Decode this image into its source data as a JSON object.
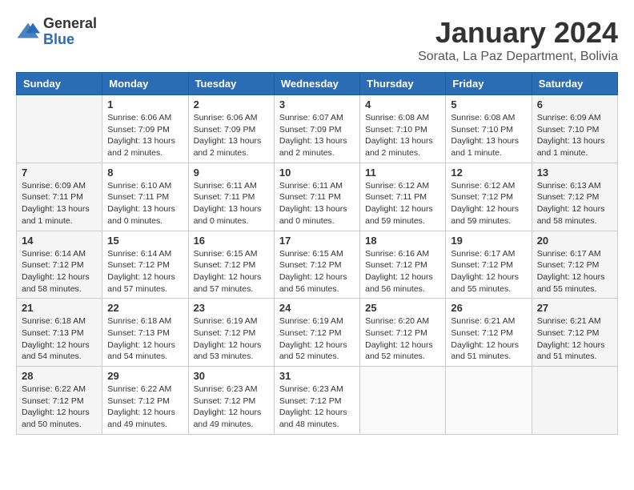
{
  "logo": {
    "general": "General",
    "blue": "Blue"
  },
  "title": "January 2024",
  "location": "Sorata, La Paz Department, Bolivia",
  "days_header": [
    "Sunday",
    "Monday",
    "Tuesday",
    "Wednesday",
    "Thursday",
    "Friday",
    "Saturday"
  ],
  "weeks": [
    [
      {
        "day": "",
        "info": ""
      },
      {
        "day": "1",
        "info": "Sunrise: 6:06 AM\nSunset: 7:09 PM\nDaylight: 13 hours and 2 minutes."
      },
      {
        "day": "2",
        "info": "Sunrise: 6:06 AM\nSunset: 7:09 PM\nDaylight: 13 hours and 2 minutes."
      },
      {
        "day": "3",
        "info": "Sunrise: 6:07 AM\nSunset: 7:09 PM\nDaylight: 13 hours and 2 minutes."
      },
      {
        "day": "4",
        "info": "Sunrise: 6:08 AM\nSunset: 7:10 PM\nDaylight: 13 hours and 2 minutes."
      },
      {
        "day": "5",
        "info": "Sunrise: 6:08 AM\nSunset: 7:10 PM\nDaylight: 13 hours and 1 minute."
      },
      {
        "day": "6",
        "info": "Sunrise: 6:09 AM\nSunset: 7:10 PM\nDaylight: 13 hours and 1 minute."
      }
    ],
    [
      {
        "day": "7",
        "info": "Sunrise: 6:09 AM\nSunset: 7:11 PM\nDaylight: 13 hours and 1 minute."
      },
      {
        "day": "8",
        "info": "Sunrise: 6:10 AM\nSunset: 7:11 PM\nDaylight: 13 hours and 0 minutes."
      },
      {
        "day": "9",
        "info": "Sunrise: 6:11 AM\nSunset: 7:11 PM\nDaylight: 13 hours and 0 minutes."
      },
      {
        "day": "10",
        "info": "Sunrise: 6:11 AM\nSunset: 7:11 PM\nDaylight: 13 hours and 0 minutes."
      },
      {
        "day": "11",
        "info": "Sunrise: 6:12 AM\nSunset: 7:11 PM\nDaylight: 12 hours and 59 minutes."
      },
      {
        "day": "12",
        "info": "Sunrise: 6:12 AM\nSunset: 7:12 PM\nDaylight: 12 hours and 59 minutes."
      },
      {
        "day": "13",
        "info": "Sunrise: 6:13 AM\nSunset: 7:12 PM\nDaylight: 12 hours and 58 minutes."
      }
    ],
    [
      {
        "day": "14",
        "info": "Sunrise: 6:14 AM\nSunset: 7:12 PM\nDaylight: 12 hours and 58 minutes."
      },
      {
        "day": "15",
        "info": "Sunrise: 6:14 AM\nSunset: 7:12 PM\nDaylight: 12 hours and 57 minutes."
      },
      {
        "day": "16",
        "info": "Sunrise: 6:15 AM\nSunset: 7:12 PM\nDaylight: 12 hours and 57 minutes."
      },
      {
        "day": "17",
        "info": "Sunrise: 6:15 AM\nSunset: 7:12 PM\nDaylight: 12 hours and 56 minutes."
      },
      {
        "day": "18",
        "info": "Sunrise: 6:16 AM\nSunset: 7:12 PM\nDaylight: 12 hours and 56 minutes."
      },
      {
        "day": "19",
        "info": "Sunrise: 6:17 AM\nSunset: 7:12 PM\nDaylight: 12 hours and 55 minutes."
      },
      {
        "day": "20",
        "info": "Sunrise: 6:17 AM\nSunset: 7:12 PM\nDaylight: 12 hours and 55 minutes."
      }
    ],
    [
      {
        "day": "21",
        "info": "Sunrise: 6:18 AM\nSunset: 7:13 PM\nDaylight: 12 hours and 54 minutes."
      },
      {
        "day": "22",
        "info": "Sunrise: 6:18 AM\nSunset: 7:13 PM\nDaylight: 12 hours and 54 minutes."
      },
      {
        "day": "23",
        "info": "Sunrise: 6:19 AM\nSunset: 7:12 PM\nDaylight: 12 hours and 53 minutes."
      },
      {
        "day": "24",
        "info": "Sunrise: 6:19 AM\nSunset: 7:12 PM\nDaylight: 12 hours and 52 minutes."
      },
      {
        "day": "25",
        "info": "Sunrise: 6:20 AM\nSunset: 7:12 PM\nDaylight: 12 hours and 52 minutes."
      },
      {
        "day": "26",
        "info": "Sunrise: 6:21 AM\nSunset: 7:12 PM\nDaylight: 12 hours and 51 minutes."
      },
      {
        "day": "27",
        "info": "Sunrise: 6:21 AM\nSunset: 7:12 PM\nDaylight: 12 hours and 51 minutes."
      }
    ],
    [
      {
        "day": "28",
        "info": "Sunrise: 6:22 AM\nSunset: 7:12 PM\nDaylight: 12 hours and 50 minutes."
      },
      {
        "day": "29",
        "info": "Sunrise: 6:22 AM\nSunset: 7:12 PM\nDaylight: 12 hours and 49 minutes."
      },
      {
        "day": "30",
        "info": "Sunrise: 6:23 AM\nSunset: 7:12 PM\nDaylight: 12 hours and 49 minutes."
      },
      {
        "day": "31",
        "info": "Sunrise: 6:23 AM\nSunset: 7:12 PM\nDaylight: 12 hours and 48 minutes."
      },
      {
        "day": "",
        "info": ""
      },
      {
        "day": "",
        "info": ""
      },
      {
        "day": "",
        "info": ""
      }
    ]
  ]
}
